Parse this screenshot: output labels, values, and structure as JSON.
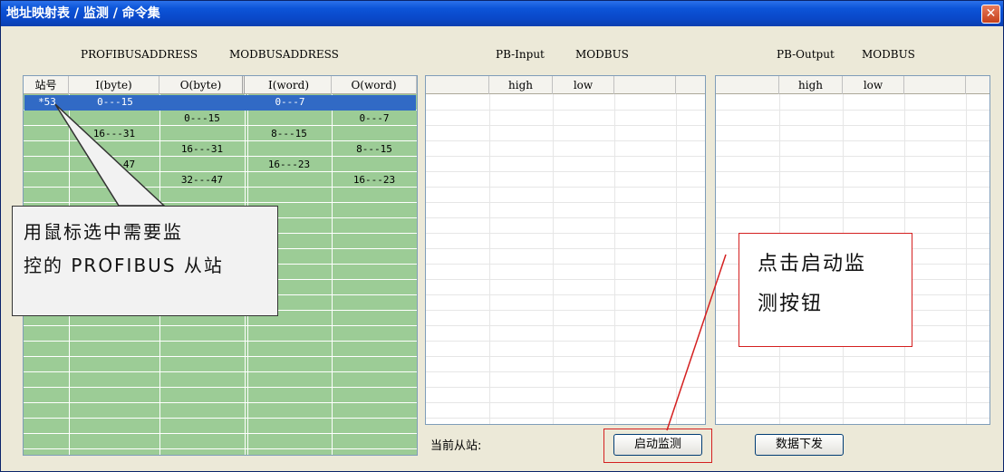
{
  "window": {
    "title": "地址映射表 / 监测 / 命令集",
    "close_glyph": "✕"
  },
  "headers": {
    "profibus_address": "PROFIBUSADDRESS",
    "modbus_address": "MODBUSADDRESS",
    "pb_input": "PB-Input",
    "pb_input_modbus": "MODBUS",
    "pb_output": "PB-Output",
    "pb_output_modbus": "MODBUS"
  },
  "address_table": {
    "columns": [
      "站号",
      "I(byte)",
      "O(byte)",
      "I(word)",
      "O(word)"
    ],
    "rows": [
      [
        "*53",
        "0---15",
        "",
        "0---7",
        ""
      ],
      [
        "",
        "",
        "0---15",
        "",
        "0---7"
      ],
      [
        "",
        "16---31",
        "",
        "8---15",
        ""
      ],
      [
        "",
        "",
        "16---31",
        "",
        "8---15"
      ],
      [
        "",
        "32---47",
        "",
        "16---23",
        ""
      ],
      [
        "",
        "",
        "32---47",
        "",
        "16---23"
      ]
    ],
    "selected_row": 0
  },
  "input_table": {
    "columns": [
      "",
      "high",
      "low",
      ""
    ]
  },
  "output_table": {
    "columns": [
      "",
      "high",
      "low",
      ""
    ]
  },
  "callouts": {
    "left_line1": "用鼠标选中需要监",
    "left_line2": "控的 PROFIBUS 从站",
    "right_line1": "点击启动监",
    "right_line2": "测按钮"
  },
  "status": {
    "current_slave_label": "当前从站:"
  },
  "buttons": {
    "start_monitor": "启动监测",
    "send_data": "数据下发"
  },
  "colors": {
    "title_bar": "#0a48c8",
    "grid_green": "#9ccc96",
    "selection": "#316ac5",
    "highlight_red": "#d42020"
  }
}
